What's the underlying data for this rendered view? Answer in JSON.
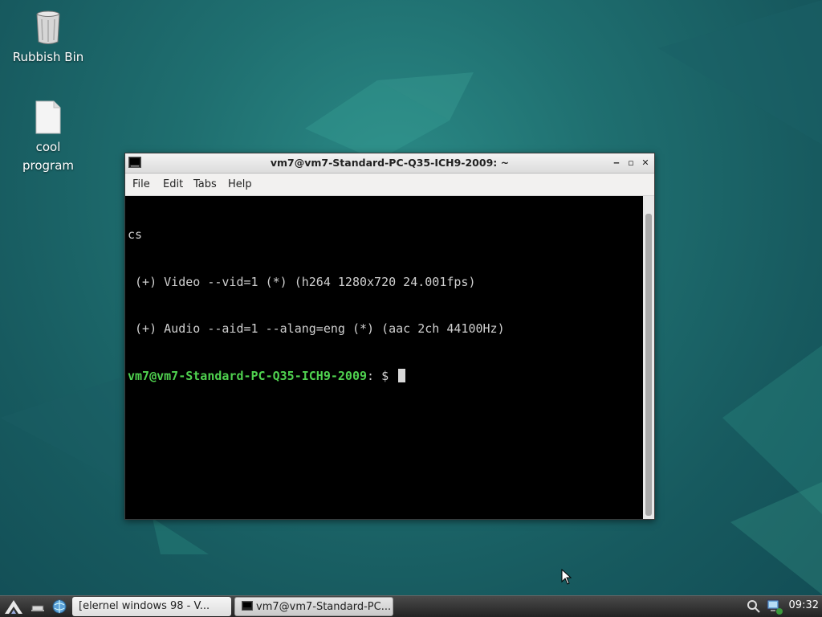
{
  "desktop": {
    "icons": [
      {
        "label": "Rubbish Bin"
      },
      {
        "label_line1": "cool",
        "label_line2": "program"
      }
    ]
  },
  "terminal": {
    "title": "vm7@vm7-Standard-PC-Q35-ICH9-2009: ~",
    "menu": [
      "File",
      "Edit",
      "Tabs",
      "Help"
    ],
    "lines": [
      "cs",
      " (+) Video --vid=1 (*) (h264 1280x720 24.001fps)",
      " (+) Audio --aid=1 --alang=eng (*) (aac 2ch 44100Hz)"
    ],
    "prompt_user": "vm7@vm7-Standard-PC-Q35-ICH9-2009",
    "prompt_suffix": ": $ ",
    "controls": {
      "minimize": "‒",
      "maximize": "▫",
      "close": "✕"
    }
  },
  "taskbar": {
    "tasks": [
      {
        "label": "[elernel windows 98 - V..."
      },
      {
        "label": "vm7@vm7-Standard-PC..."
      }
    ],
    "clock": "09:32"
  },
  "colors": {
    "desktop": "#1f6f70",
    "prompt_green": "#4fd14f",
    "terminal_bg": "#000000",
    "terminal_fg": "#d0d0d0"
  }
}
